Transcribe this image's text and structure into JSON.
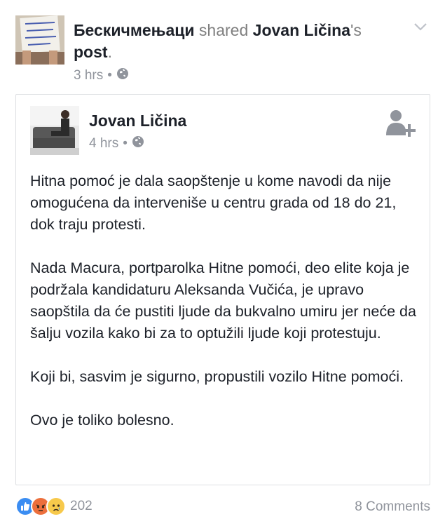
{
  "outer": {
    "page_name": "Бескичмењаци",
    "verb": " shared ",
    "author_name": "Jovan Ličina",
    "post_suffix": "'s",
    "post_word": "post",
    "post_end": ".",
    "time": "3 hrs",
    "dot": "•",
    "avatar_sign_text": "VIDI ŠTA SU NAM URADILI OD ZEMLJE"
  },
  "shared": {
    "author_name": "Jovan Ličina",
    "time": "4 hrs",
    "dot": "•",
    "paragraphs": [
      "Hitna pomoć je dala saopštenje u kome navodi da nije omogućena da interveniše u centru grada od 18 do 21, dok traju protesti.",
      "Nada Macura, portparolka Hitne pomoći, deo elite koja je podržala kandidaturu Aleksanda Vučića, je upravo saopštila da će pustiti ljude da bukvalno umiru jer neće da šalju vozila kako bi za to optužili ljude koji protestuju.",
      "Koji bi, sasvim je sigurno, propustili vozilo Hitne pomoći.",
      "Ovo je toliko bolesno."
    ]
  },
  "footer": {
    "reaction_count": "202",
    "comments": "8 Comments"
  },
  "colors": {
    "meta": "#90949c",
    "like": "#3b8df2",
    "angry": "#ec6f3c",
    "sad": "#f7c94b"
  },
  "icons": [
    "globe-icon",
    "chevron-down-icon",
    "add-friend-icon",
    "like-reaction-icon",
    "angry-reaction-icon",
    "sad-reaction-icon"
  ]
}
